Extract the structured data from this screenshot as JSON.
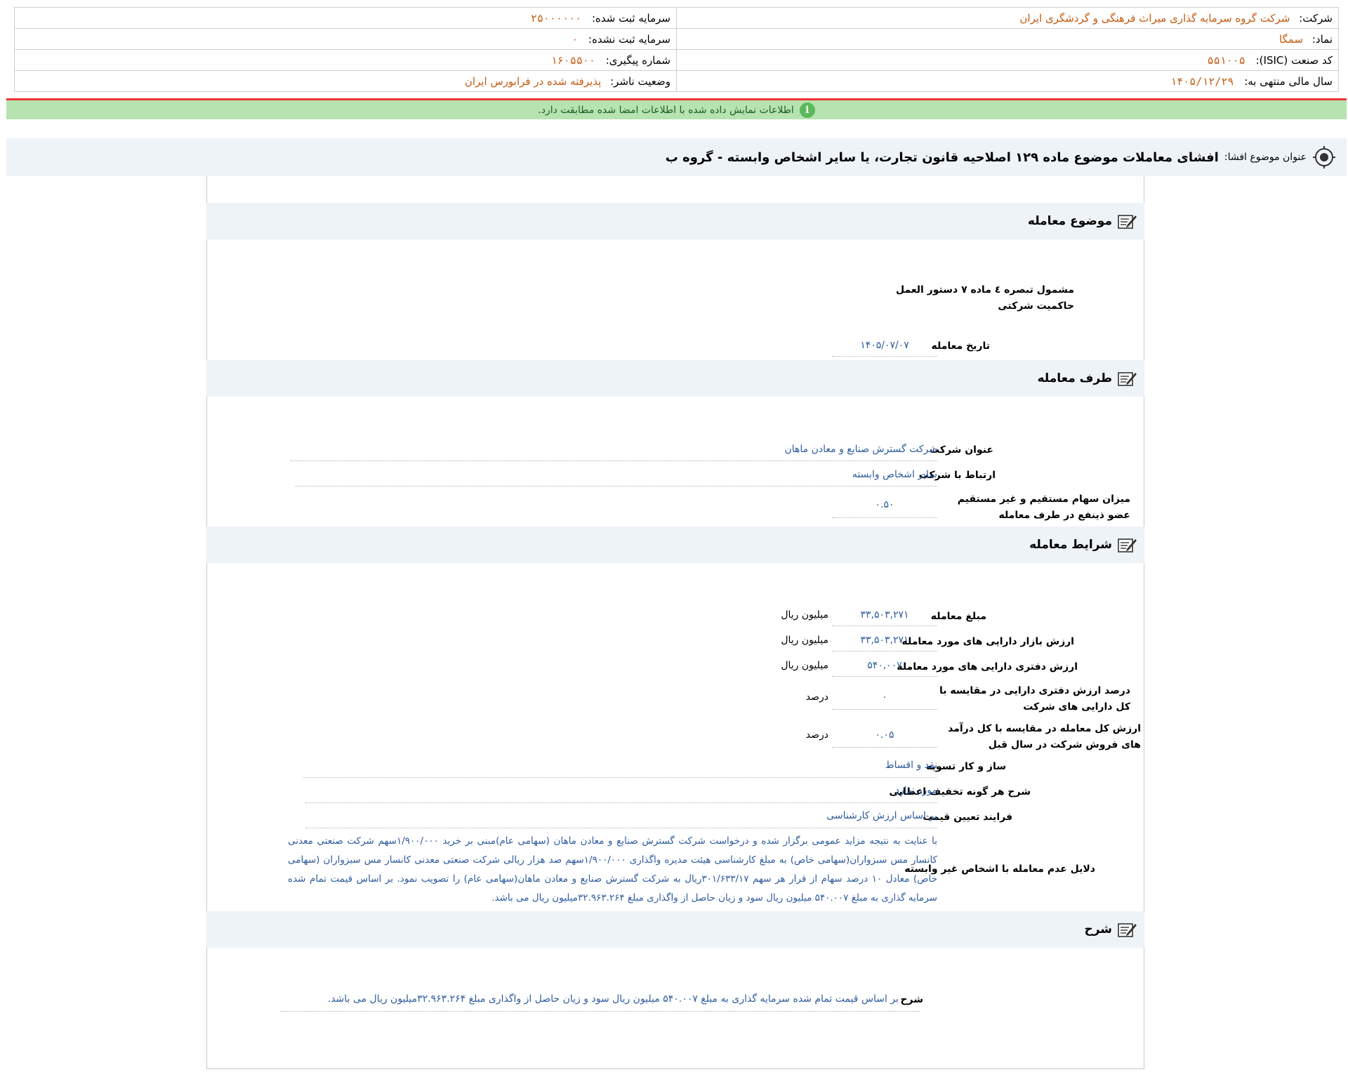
{
  "header": {
    "company_label": "شرکت:",
    "company_value": "شرکت گروه سرمایه گذاری میراث فرهنگی و گردشگری ایران",
    "symbol_label": "نماد:",
    "symbol_value": "سمگا",
    "isic_label": "کد صنعت (ISIC):",
    "isic_value": "۵۵۱۰۰۵",
    "fiscal_label": "سال مالی منتهی به:",
    "fiscal_value": "۱۴۰۵/۱۲/۲۹",
    "reg_capital_label": "سرمایه ثبت شده:",
    "reg_capital_value": "۲۵۰۰۰۰۰۰",
    "unreg_capital_label": "سرمایه ثبت نشده:",
    "unreg_capital_value": "۰",
    "tracking_label": "شماره پیگیری:",
    "tracking_value": "۱۶۰۵۵۰۰",
    "status_label": "وضعیت ناشر:",
    "status_value": "پذیرفته شده در فرابورس ایران"
  },
  "notice": {
    "icon": "i",
    "text": "اطلاعات نمایش داده شده با اطلاعات امضا شده مطابقت دارد."
  },
  "subject": {
    "label": "عنوان موضوع افشا:",
    "title": "افشای معاملات موضوع ماده ۱۲۹ اصلاحیه قانون تجارت، یا سایر اشخاص وابسته - گروه ب"
  },
  "sections": {
    "subject_title": "موضوع معامله",
    "party_title": "طرف معامله",
    "terms_title": "شرایط معامله",
    "desc_title": "شرح"
  },
  "subject_section": {
    "governance_note": "مشمول تبصره ٤ ماده ٧ دستور العمل حاکمیت شرکتی",
    "date_label": "تاریخ معامله",
    "date_value": "۱۴۰۵/۰۷/۰۷"
  },
  "party_section": {
    "company_label": "عنوان شرکت",
    "company_value": "شرکت گسترش صنایع و معادن ماهان",
    "relation_label": "ارتباط با شرکت",
    "relation_value": "سایر اشخاص وابسته",
    "shares_label": "میزان سهام مستقیم و غیر مستقیم عضو ذینفع در طرف معامله",
    "shares_value": "۰.۵۰"
  },
  "terms_section": {
    "amount_label": "مبلغ معامله",
    "amount_value": "۳۳,۵۰۳,۲۷۱",
    "amount_unit": "میلیون ریال",
    "market_label": "ارزش بازار دارایی های مورد معامله",
    "market_value": "۳۳,۵۰۳,۲۷۱",
    "market_unit": "میلیون ریال",
    "book_label": "ارزش دفتری دارایی های مورد معامله",
    "book_value": "۵۴۰,۰۰۷",
    "book_unit": "میلیون ریال",
    "book_pct_label": "درصد ارزش دفتری دارایی در مقایسه با کل دارایی های شرکت",
    "book_pct_value": "۰",
    "book_pct_unit": "درصد",
    "sales_pct_label": "ارزش کل معامله در مقایسه با کل درآمد های فروش شرکت در سال قبل",
    "sales_pct_value": "۰.۰۵",
    "sales_pct_unit": "درصد",
    "settlement_label": "ساز و کار تسویه",
    "settlement_value": "نقد و اقساط",
    "discount_label": "شرح هر گونه تخفیف اعطایی",
    "discount_value": "مورد ندارد",
    "pricing_label": "فرایند تعیین قیمت",
    "pricing_value": "بر اساس ارزش کارشناسی",
    "reasons_label": "دلایل عدم معامله با اشخاص غیر وابسته",
    "reasons_value": "با عنایت به نتیجه مزاید عمومی برگزار شده و درخواست شرکت گسترش صنایع و معادن ماهان (سهامی عام)مبنی بر خرید ۱/۹۰۰/۰۰۰سهم شرکت صنعتی معدنی کانسار مس سبزواران(سهامی خاص) به مبلغ کارشناسی هیئت مدیره واگذاری ۱/۹۰۰/۰۰۰سهم صد هزار ریالی شرکت صنعتی معدنی کانسار مس سبزواران (سهامی خاص) معادل ۱۰ درصد سهام از قرار هر سهم ۳۰۱/۶۳۳/۱۷ریال به شرکت گسترش صنایع و معادن ماهان(سهامی عام) را تصویب نمود. بر اساس قیمت تمام شده سرمایه گذاری به مبلغ ۵۴۰.۰۰۷ میلیون ریال سود و زیان حاصل از واگذاری مبلغ ۳۲.۹۶۳.۲۶۴میلیون ریال می باشد."
  },
  "desc_section": {
    "label": "شرح",
    "value": "بر اساس قیمت تمام شده سرمایه گذاری به مبلغ ۵۴۰.۰۰۷ میلیون ریال سود و زیان حاصل از واگذاری مبلغ ۳۲.۹۶۳.۲۶۴میلیون ریال می باشد."
  }
}
